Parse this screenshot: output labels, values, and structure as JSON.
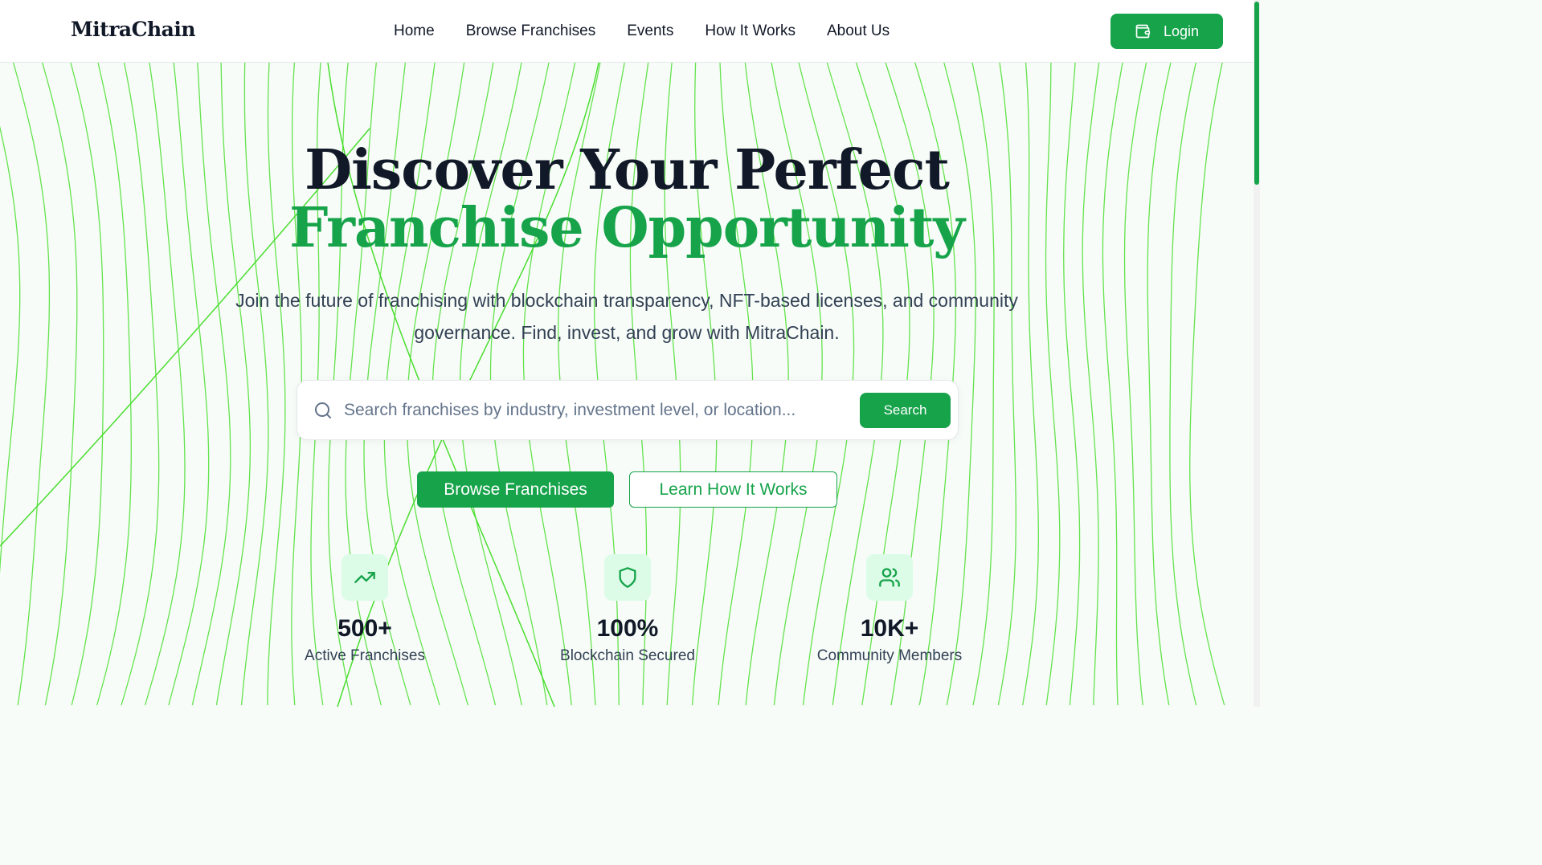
{
  "header": {
    "logo": "MitraChain",
    "nav": [
      "Home",
      "Browse Franchises",
      "Events",
      "How It Works",
      "About Us"
    ],
    "login_label": "Login",
    "login_icon": "wallet-icon"
  },
  "hero": {
    "title_line1": "Discover Your Perfect",
    "title_line2": "Franchise Opportunity",
    "subtitle": "Join the future of franchising with blockchain transparency, NFT-based licenses, and community governance. Find, invest, and grow with MitraChain."
  },
  "search": {
    "placeholder": "Search franchises by industry, investment level, or location...",
    "value": "",
    "button_label": "Search"
  },
  "cta": {
    "primary_label": "Browse Franchises",
    "secondary_label": "Learn How It Works"
  },
  "stats": [
    {
      "icon": "trending-up-icon",
      "value": "500+",
      "label": "Active Franchises"
    },
    {
      "icon": "shield-icon",
      "value": "100%",
      "label": "Blockchain Secured"
    },
    {
      "icon": "users-icon",
      "value": "10K+",
      "label": "Community Members"
    }
  ],
  "colors": {
    "accent": "#16a34a",
    "accent_light": "#dcfce7",
    "line": "#4ade2f",
    "text_dark": "#111827"
  }
}
